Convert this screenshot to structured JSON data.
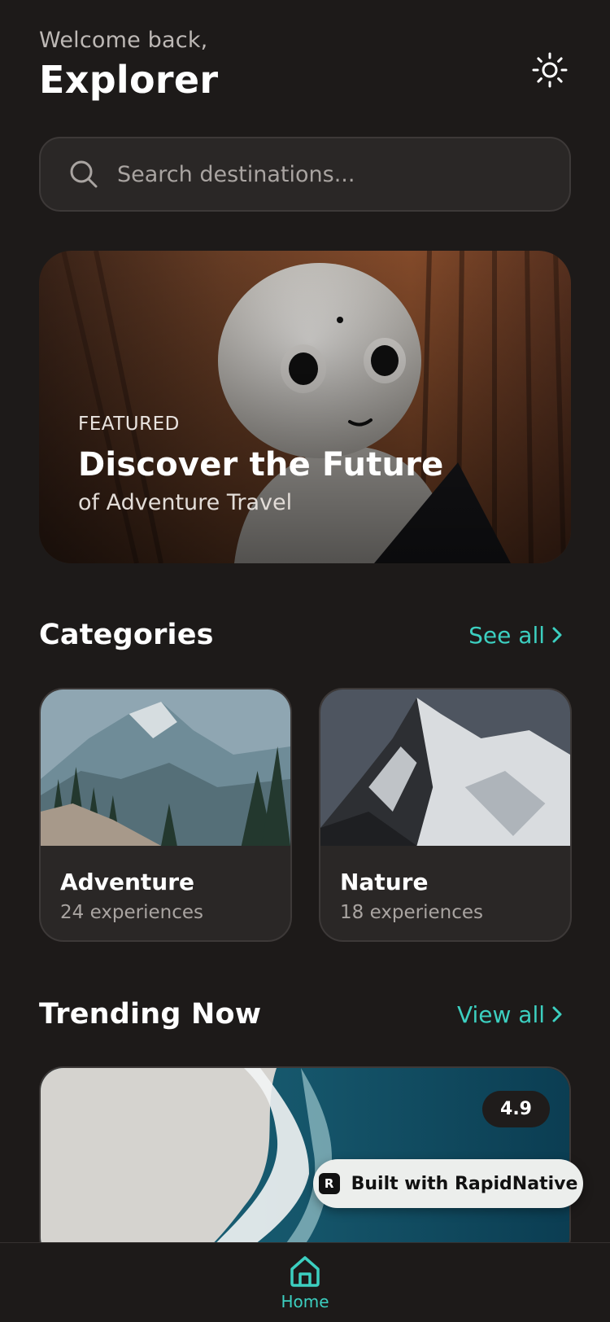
{
  "header": {
    "welcome": "Welcome back,",
    "username": "Explorer",
    "theme_icon": "sun-icon"
  },
  "search": {
    "placeholder": "Search destinations...",
    "value": ""
  },
  "hero": {
    "kicker": "FEATURED",
    "title": "Discover the Future",
    "subtitle": "of Adventure Travel"
  },
  "categories": {
    "title": "Categories",
    "see_all": "See all",
    "items": [
      {
        "name": "Adventure",
        "count": "24 experiences"
      },
      {
        "name": "Nature",
        "count": "18 experiences"
      }
    ]
  },
  "trending": {
    "title": "Trending Now",
    "view_all": "View all",
    "items": [
      {
        "rating": "4.9"
      }
    ]
  },
  "badge": {
    "label": "Built with RapidNative"
  },
  "tabbar": {
    "items": [
      {
        "label": "Home",
        "icon": "home-icon"
      }
    ]
  },
  "colors": {
    "background": "#1d1a19",
    "card": "#2a2726",
    "accent": "#3ccfc0",
    "muted_text": "#a9a4a1"
  }
}
